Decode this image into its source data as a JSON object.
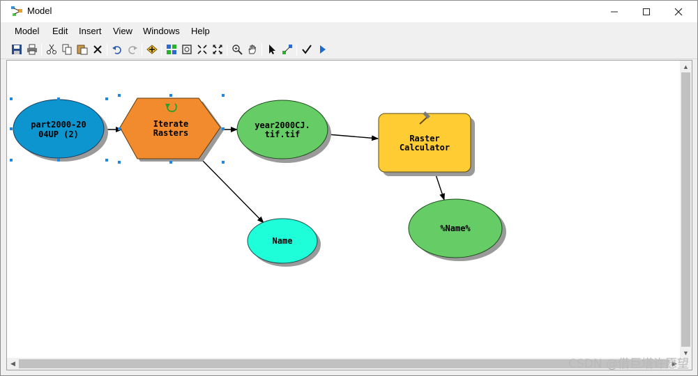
{
  "window": {
    "title": "Model",
    "minimize_glyph": "—",
    "maximize_glyph": "☐",
    "close_glyph": "✕"
  },
  "menu": {
    "items": [
      "Model",
      "Edit",
      "Insert",
      "View",
      "Windows",
      "Help"
    ]
  },
  "toolbar": {
    "icons": [
      "save-icon",
      "print-icon",
      "cut-icon",
      "copy-icon",
      "paste-icon",
      "delete-icon",
      "undo-icon",
      "redo-icon",
      "add-data-icon",
      "auto-layout-icon",
      "full-extent-icon",
      "fixed-zoom-in-icon",
      "fixed-zoom-out-icon",
      "zoom-in-icon",
      "pan-icon",
      "select-icon",
      "connect-icon",
      "validate-icon",
      "run-icon"
    ]
  },
  "model": {
    "nodes": {
      "input": {
        "line1": "part2000-20",
        "line2": "04UP (2)",
        "color": "#0d95cf"
      },
      "iterator": {
        "line1": "Iterate",
        "line2": "Rasters",
        "color": "#f28a2e"
      },
      "output_raster": {
        "line1": "year2000CJ.",
        "line2": "tif.tif",
        "color": "#66cc66"
      },
      "tool": {
        "line1": "Raster",
        "line2": "Calculator",
        "color": "#ffcc33"
      },
      "name_var": {
        "label": "Name",
        "color": "#1effd9"
      },
      "result": {
        "label": "%Name%",
        "color": "#66cc66"
      }
    }
  },
  "watermark": "CSDN @借巨塔许愿望"
}
